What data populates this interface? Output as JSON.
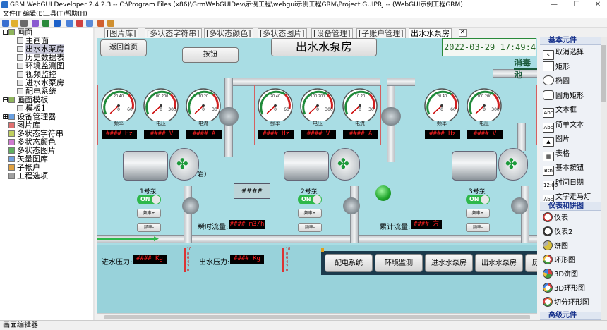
{
  "window": {
    "title": "GRM WebGUI Developer 2.4.2.3 -- C:\\Program Files (x86)\\GrmWebGUIDev\\示例工程\\webgui示例工程GRM\\Project.GUIPRJ -- (WebGUI示例工程GRM)",
    "min": "—",
    "max": "☐",
    "close": "✕"
  },
  "menu": [
    "文件(F)",
    "编辑(E)",
    "工具(T)",
    "帮助(H)"
  ],
  "tree": {
    "items": [
      {
        "label": "画面",
        "expander": "⊟"
      },
      {
        "label": "主画面"
      },
      {
        "label": "出水水泵房"
      },
      {
        "label": "历史数据表"
      },
      {
        "label": "环境监测图"
      },
      {
        "label": "视频监控"
      },
      {
        "label": "进水水泵房"
      },
      {
        "label": "配电系统"
      },
      {
        "label": "画面模板",
        "expander": "⊟"
      },
      {
        "label": "模板1"
      },
      {
        "label": "设备管理器",
        "expander": "⊞"
      },
      {
        "label": "图片库"
      },
      {
        "label": "多状态字符串"
      },
      {
        "label": "多状态颜色"
      },
      {
        "label": "多状态图片"
      },
      {
        "label": "矢量图库"
      },
      {
        "label": "子帐户"
      },
      {
        "label": "工程选项"
      }
    ]
  },
  "tabs": [
    {
      "label": "[图片库]"
    },
    {
      "label": "[多状态字符串]"
    },
    {
      "label": "[多状态颜色]"
    },
    {
      "label": "[多状态图片]"
    },
    {
      "label": "[设备管理]"
    },
    {
      "label": "[子账户管理]"
    },
    {
      "label": "出水水泵房"
    }
  ],
  "tab_close": "✕",
  "canvas": {
    "back_button": "返回首页",
    "button": "按钮",
    "page_title": "出水水泵房",
    "datetime": "2022-03-29  17:49:45",
    "right_label": "消毒池",
    "gauge_labels": [
      "频率",
      "电压",
      "电流"
    ],
    "gauge_scales": [
      {
        "lo": "0",
        "mid": "20 40",
        "hi": "60"
      },
      {
        "lo": "0",
        "mid": "100 200",
        "hi": "300"
      },
      {
        "lo": "0",
        "mid": "10 20",
        "hi": "30"
      }
    ],
    "readouts": [
      "#### Hz",
      "#### V",
      "#### A"
    ],
    "pumps": [
      {
        "name": "1号泵",
        "on": "ON",
        "btn1": "频率+",
        "btn2": "频率-"
      },
      {
        "name": "2号泵",
        "on": "ON",
        "btn1": "频率+",
        "btn2": "频率-"
      },
      {
        "name": "3号泵",
        "on": "ON",
        "btn1": "频率+",
        "btn2": "频率-"
      }
    ],
    "center_box": "####",
    "clipped_text": "岩）",
    "instant_flow_label": "瞬时流量:",
    "instant_flow_value": "#### m3/h",
    "total_flow_label": "累计流量:",
    "total_flow_value": "#### 方",
    "inlet_pressure_label": "进水压力:",
    "inlet_pressure_value": "#### Kg",
    "outlet_pressure_label": "出水压力:",
    "outlet_pressure_value": "#### Kg",
    "bar_ticks": [
      "10",
      "8",
      "6",
      "4",
      "2",
      "0"
    ],
    "nav": [
      "配电系统",
      "环境监测",
      "进水水泵房",
      "出水水泵房",
      "历史"
    ]
  },
  "palette": {
    "basic_header": "基本元件",
    "basic": [
      {
        "label": "取消选择",
        "icon": "pointer-icon",
        "glyph": "↖"
      },
      {
        "label": "矩形",
        "icon": "rectangle-icon",
        "glyph": ""
      },
      {
        "label": "椭圆",
        "icon": "ellipse-icon",
        "glyph": ""
      },
      {
        "label": "圆角矩形",
        "icon": "rounded-rect-icon",
        "glyph": ""
      },
      {
        "label": "文本框",
        "icon": "textbox-icon",
        "glyph": "Abc"
      },
      {
        "label": "简单文本",
        "icon": "simple-text-icon",
        "glyph": "Abc"
      },
      {
        "label": "图片",
        "icon": "picture-icon",
        "glyph": "▲"
      },
      {
        "label": "表格",
        "icon": "table-icon",
        "glyph": "▦"
      },
      {
        "label": "基本按钮",
        "icon": "button-icon",
        "glyph": "Btn"
      },
      {
        "label": "时间日期",
        "icon": "datetime-icon",
        "glyph": "12:00"
      },
      {
        "label": "文字走马灯",
        "icon": "marquee-icon",
        "glyph": "Abc"
      }
    ],
    "meter_header": "仪表和饼图",
    "meters": [
      {
        "label": "仪表",
        "icon": "gauge-icon"
      },
      {
        "label": "仪表2",
        "icon": "gauge2-icon"
      },
      {
        "label": "饼图",
        "icon": "pie-icon"
      },
      {
        "label": "环形图",
        "icon": "ring-icon"
      },
      {
        "label": "3D饼图",
        "icon": "pie3d-icon"
      },
      {
        "label": "3D环形图",
        "icon": "ring3d-icon"
      },
      {
        "label": "切分环形图",
        "icon": "split-ring-icon"
      }
    ],
    "advanced_header": "高级元件"
  },
  "status": "画面编辑器",
  "colors": {
    "canvas_bg": "#a9dde4",
    "accent": "#15308a",
    "led": "#ff2020"
  }
}
